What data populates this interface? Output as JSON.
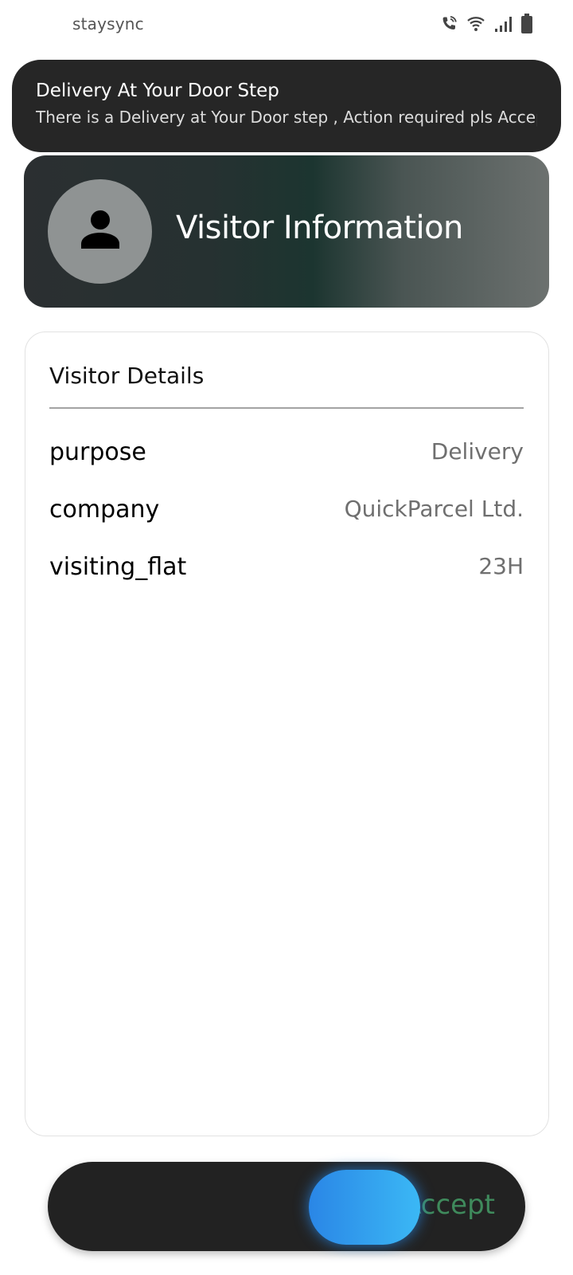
{
  "status_bar": {
    "app_name": "staysync",
    "icons": [
      "call-wifi-icon",
      "wifi-icon",
      "signal-icon",
      "battery-icon"
    ]
  },
  "notification": {
    "title": "Delivery At Your Door Step",
    "text": "There is a Delivery at Your Door step , Action required pls Accept.."
  },
  "header": {
    "title": "Visitor Information",
    "avatar_icon": "person-icon"
  },
  "details": {
    "title": "Visitor Details",
    "rows": [
      {
        "key": "purpose",
        "value": "Delivery"
      },
      {
        "key": "company",
        "value": "QuickParcel Ltd."
      },
      {
        "key": "visiting_flat",
        "value": "23H"
      }
    ]
  },
  "slider": {
    "label": "Accept",
    "label_color": "#3f8a5c",
    "knob_color": "#2a86e6"
  },
  "colors": {
    "notification_bg": "#262626",
    "slider_bg": "#222222",
    "avatar_bg": "#8f9393"
  }
}
